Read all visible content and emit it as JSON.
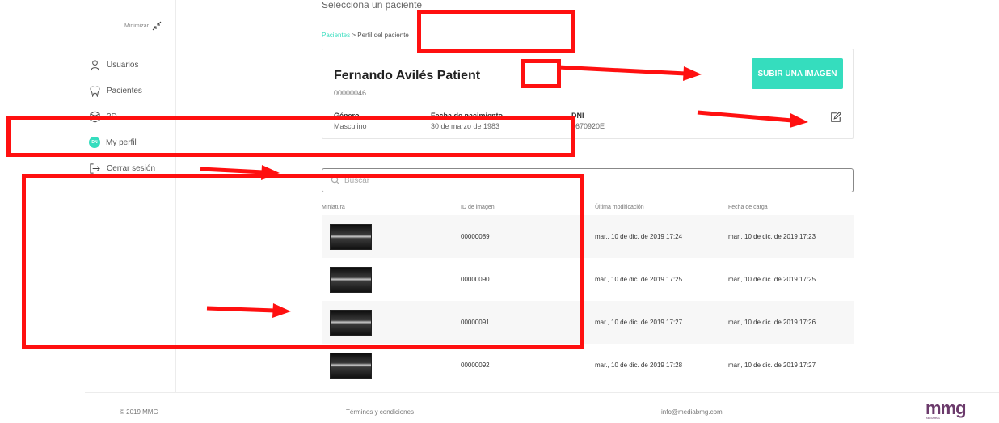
{
  "sidebar": {
    "minimize_label": "Minimizar",
    "items": [
      {
        "label": "Usuarios",
        "icon": "users-icon"
      },
      {
        "label": "Pacientes",
        "icon": "tooth-icon"
      },
      {
        "label": "3D",
        "icon": "cube-icon"
      },
      {
        "label": "My perfil",
        "icon": "avatar-icon",
        "badge": "DN"
      },
      {
        "label": "Cerrar sesión",
        "icon": "logout-icon"
      }
    ]
  },
  "main": {
    "heading": "Selecciona un paciente",
    "breadcrumb": {
      "link": "Pacientes",
      "separator": " > ",
      "current": "Perfil del paciente"
    },
    "patient": {
      "name": "Fernando Avilés Patient",
      "id": "00000046",
      "gender_label": "Género",
      "gender": "Masculino",
      "birth_label": "Fecha de nacimiento",
      "birth": "30 de marzo de 1983",
      "dni_label": "DNI",
      "dni": "2670920E"
    },
    "upload_button": "SUBIR UNA IMAGEN",
    "search_placeholder": "Buscar",
    "table": {
      "headers": [
        "Miniatura",
        "ID de imagen",
        "Última modificación",
        "Fecha de carga"
      ],
      "rows": [
        {
          "id": "00000089",
          "modified": "mar., 10 de dic. de 2019 17:24",
          "uploaded": "mar., 10 de dic. de 2019 17:23"
        },
        {
          "id": "00000090",
          "modified": "mar., 10 de dic. de 2019 17:25",
          "uploaded": "mar., 10 de dic. de 2019 17:25"
        },
        {
          "id": "00000091",
          "modified": "mar., 10 de dic. de 2019 17:27",
          "uploaded": "mar., 10 de dic. de 2019 17:26"
        },
        {
          "id": "00000092",
          "modified": "mar., 10 de dic. de 2019 17:28",
          "uploaded": "mar., 10 de dic. de 2019 17:27"
        }
      ]
    }
  },
  "footer": {
    "copyright": "© 2019 MMG",
    "terms": "Términos y condiciones",
    "email": "info@mediabmg.com",
    "logo": "mmg",
    "logo_sub": "MEDIA BMG"
  },
  "colors": {
    "accent": "#35ddbe",
    "annotation": "#ff1010",
    "logo": "#6b3a6b"
  }
}
